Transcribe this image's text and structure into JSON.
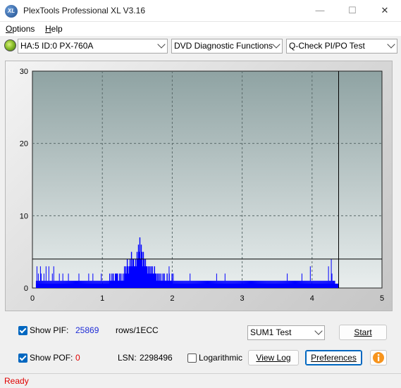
{
  "window": {
    "title": "PlexTools Professional XL V3.16",
    "icon_text": "XL",
    "controls": {
      "minimize": "—",
      "maximize": "☐",
      "close": "✕"
    }
  },
  "menu": {
    "items": [
      {
        "label": "Options",
        "accel": "O",
        "rest": "ptions"
      },
      {
        "label": "Help",
        "accel": "H",
        "rest": "elp"
      }
    ]
  },
  "toolbar": {
    "drive": "HA:5 ID:0  PX-760A",
    "function": "DVD Diagnostic Functions",
    "test": "Q-Check PI/PO Test"
  },
  "chart_data": {
    "type": "bar",
    "title": "",
    "xlabel": "",
    "ylabel": "",
    "xlim": [
      0,
      5
    ],
    "ylim": [
      0,
      30
    ],
    "x_ticks": [
      "0",
      "1",
      "2",
      "3",
      "4",
      "5"
    ],
    "y_ticks": [
      "0",
      "10",
      "20",
      "30"
    ],
    "grid": true,
    "threshold_line": 4,
    "end_marker_x": 4.38,
    "series": [
      {
        "color": "#0000ff",
        "x_step": 0.01,
        "values": [
          1,
          3,
          1,
          2,
          1,
          1,
          3,
          2,
          1,
          1,
          1,
          2,
          1,
          1,
          3,
          1,
          1,
          1,
          3,
          1,
          1,
          1,
          1,
          2,
          1,
          3,
          1,
          1,
          1,
          1,
          1,
          1,
          1,
          2,
          1,
          1,
          1,
          1,
          2,
          1,
          1,
          1,
          1,
          1,
          1,
          1,
          2,
          1,
          1,
          1,
          1,
          1,
          1,
          1,
          1,
          1,
          1,
          1,
          1,
          1,
          1,
          2,
          1,
          1,
          1,
          1,
          1,
          1,
          1,
          1,
          1,
          1,
          1,
          1,
          1,
          2,
          1,
          1,
          1,
          1,
          1,
          2,
          1,
          1,
          1,
          1,
          1,
          1,
          1,
          1,
          1,
          1,
          1,
          2,
          1,
          1,
          1,
          1,
          1,
          1,
          1,
          1,
          1,
          1,
          1,
          1,
          1,
          1,
          1,
          1,
          1,
          1,
          1,
          1,
          2,
          1,
          1,
          1,
          1,
          1,
          1,
          1,
          1,
          1,
          1,
          1,
          1,
          1,
          1,
          2,
          1,
          1,
          1,
          1,
          1,
          1,
          1,
          1,
          1,
          1,
          1,
          1,
          1,
          1,
          1,
          1,
          1,
          1,
          1,
          1,
          2,
          1,
          1,
          1,
          1,
          1,
          1,
          1,
          1,
          1,
          1,
          1,
          1,
          1,
          1,
          1,
          1,
          1,
          1,
          1,
          1,
          1,
          1,
          1,
          1,
          1,
          2,
          1,
          1,
          1,
          1,
          1,
          1,
          2,
          1,
          1,
          1,
          1,
          1,
          1,
          3,
          1,
          1,
          1,
          1,
          1,
          2,
          1,
          1,
          1,
          1,
          1,
          1,
          1,
          1,
          1,
          1,
          1,
          1,
          1,
          1,
          1,
          1,
          1,
          1,
          1,
          1,
          1,
          1,
          1,
          2,
          1,
          1,
          1,
          1,
          1,
          1,
          1,
          1,
          1,
          1,
          1,
          1,
          1,
          1,
          1,
          1,
          1,
          1,
          1,
          1,
          1,
          1,
          1,
          1,
          1,
          1,
          1,
          1,
          1,
          1,
          1,
          1,
          1,
          1,
          1,
          1,
          1,
          2,
          1,
          1,
          1,
          1,
          1,
          1,
          1,
          1,
          1,
          1,
          1,
          2,
          1,
          1,
          1,
          1,
          1,
          1,
          1,
          1,
          1,
          1,
          1,
          1,
          1,
          1,
          1,
          1,
          1,
          1,
          1,
          1,
          1,
          1,
          1,
          1,
          1,
          1,
          1,
          1,
          1,
          1,
          1,
          1,
          1,
          1,
          1,
          1,
          1,
          1,
          1,
          1,
          1,
          1,
          1,
          1,
          1,
          1,
          1,
          1,
          1,
          1,
          1,
          1,
          1,
          1,
          1,
          1,
          1,
          1,
          1,
          1,
          1,
          1,
          1,
          1,
          1,
          1,
          1,
          1,
          1,
          1,
          1,
          1,
          1,
          1,
          1,
          1,
          1,
          1,
          1,
          1,
          1,
          1,
          1,
          1,
          1,
          1,
          1,
          1,
          2,
          1,
          1,
          1,
          1,
          1,
          1,
          1,
          1,
          1,
          1,
          1,
          1,
          1,
          1,
          1,
          1,
          1,
          1,
          1,
          1,
          2,
          1,
          1,
          1,
          1,
          1,
          1,
          1,
          1,
          1,
          1,
          1,
          3,
          1,
          1,
          1,
          1,
          1,
          1,
          1,
          1,
          1,
          1,
          1,
          1,
          1,
          1,
          1,
          1,
          1,
          1,
          1,
          1,
          1,
          1,
          1,
          1,
          1,
          3,
          1,
          1,
          1,
          4,
          2,
          1,
          1,
          1,
          1
        ]
      },
      {
        "color": "#0000ff",
        "x_step": 0.01,
        "x_start": 1.1,
        "values": [
          2,
          1,
          1,
          2,
          1,
          2,
          1,
          1,
          2,
          1,
          2,
          2,
          1,
          1,
          2,
          1,
          2,
          1,
          1,
          2,
          1,
          3,
          2,
          3,
          2,
          4,
          3,
          2,
          3,
          4,
          3,
          5,
          3,
          4,
          4,
          3,
          3,
          4,
          3,
          5,
          4,
          6,
          5,
          7,
          4,
          6,
          5,
          3,
          5,
          4,
          3,
          4,
          3,
          3,
          2,
          3,
          2,
          3,
          2,
          3,
          2,
          3,
          2,
          2,
          3,
          2,
          2,
          1,
          2,
          1,
          2,
          1,
          1,
          2,
          1,
          1,
          2,
          1,
          2,
          1,
          1,
          1,
          2,
          1,
          1,
          2,
          1,
          1,
          1,
          2
        ]
      }
    ]
  },
  "bottom": {
    "show_pif_label": "Show PIF:",
    "show_pif_accel": "I",
    "pif_value": "25869",
    "pif_unit": "rows/1ECC",
    "show_pof_label": "Show POF:",
    "pof_value": "0",
    "lsn_label": "LSN:",
    "lsn_value": "2298496",
    "logarithmic_label": "Logarithmic",
    "test_mode": "SUM1 Test",
    "start_label": "Start",
    "view_log_label": "View Log",
    "preferences_label": "Preferences"
  },
  "status": {
    "text": "Ready"
  },
  "colors": {
    "plot_bg_top": "#8fa3a3",
    "plot_bg_bottom": "#e9eeee",
    "series": "#0000ff",
    "pif_value": "#1d2bd6",
    "pof_value": "#e00000",
    "status_text": "#e00000",
    "accent": "#0067c0"
  }
}
